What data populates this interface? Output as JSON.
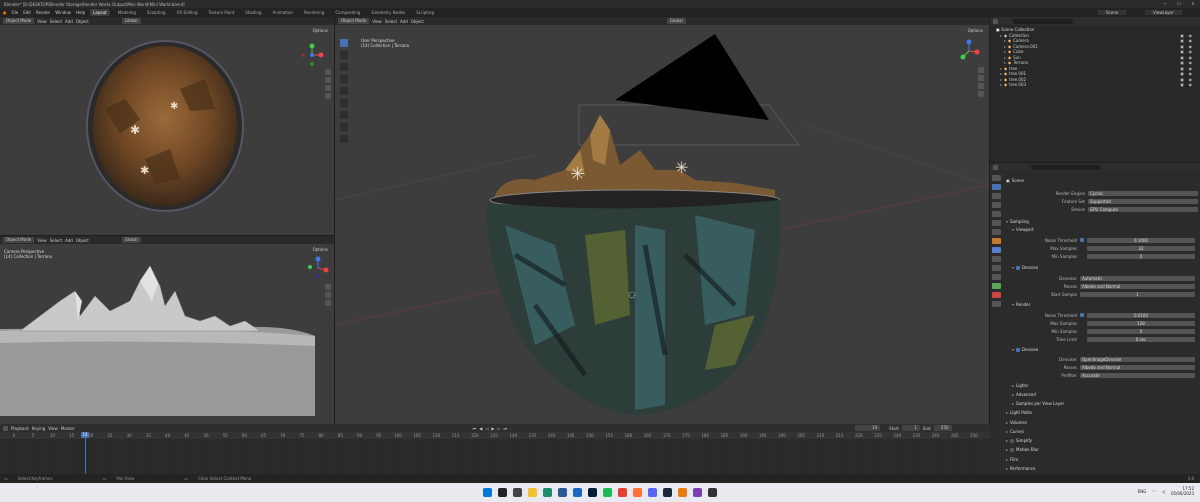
{
  "window": {
    "title": "Blender* [E:\\DESKTOP\\Blender Storage\\Render Works Output\\Mini World\\Mini World.blend]",
    "controls": [
      "—",
      "☐",
      "✕"
    ]
  },
  "menu": {
    "items": [
      "File",
      "Edit",
      "Render",
      "Window",
      "Help"
    ],
    "workspaces": [
      "Layout",
      "Modeling",
      "Sculpting",
      "UV Editing",
      "Texture Paint",
      "Shading",
      "Animation",
      "Rendering",
      "Compositing",
      "Geometry Nodes",
      "Scripting"
    ],
    "active_workspace": "Layout",
    "scene": "Scene",
    "view_layer": "ViewLayer"
  },
  "viewport_header": {
    "mode": "Object Mode",
    "view": "View",
    "select": "Select",
    "add": "Add",
    "object": "Object",
    "orientation": "Global",
    "options": "Options"
  },
  "viewports": {
    "main": {
      "perspective": "User Perspective",
      "collection": "(14) Collection | Terrano"
    },
    "bottom_left": {
      "perspective": "Camera Perspective",
      "collection": "(14) Collection | Terrano"
    }
  },
  "outliner": {
    "root": "Scene Collection",
    "items": [
      {
        "name": "Collection",
        "depth": 1
      },
      {
        "name": "Camera",
        "depth": 2
      },
      {
        "name": "Camera.001",
        "depth": 2
      },
      {
        "name": "Cube",
        "depth": 2
      },
      {
        "name": "Sun",
        "depth": 2
      },
      {
        "name": "Terrano",
        "depth": 2
      },
      {
        "name": "tree",
        "depth": 1
      },
      {
        "name": "tree.001",
        "depth": 1
      },
      {
        "name": "tree.002",
        "depth": 1
      },
      {
        "name": "tree.003",
        "depth": 1
      }
    ]
  },
  "properties": {
    "scene_name": "Scene",
    "render_engine": {
      "label": "Render Engine",
      "value": "Cycles"
    },
    "feature_set": {
      "label": "Feature Set",
      "value": "Supported"
    },
    "device": {
      "label": "Device",
      "value": "GPU Compute"
    },
    "sampling": "Sampling",
    "viewport": {
      "title": "Viewport",
      "noise_threshold": {
        "label": "Noise Threshold",
        "value": "0.1000"
      },
      "max_samples": {
        "label": "Max Samples",
        "value": "32"
      },
      "min_samples": {
        "label": "Min Samples",
        "value": "0"
      },
      "denoise": "Denoise",
      "denoiser": {
        "label": "Denoiser",
        "value": "Automatic"
      },
      "passes": {
        "label": "Passes",
        "value": "Albedo and Normal"
      },
      "start_sample": {
        "label": "Start Sample",
        "value": "1"
      }
    },
    "render": {
      "title": "Render",
      "noise_threshold": {
        "label": "Noise Threshold",
        "value": "0.0100"
      },
      "max_samples": {
        "label": "Max Samples",
        "value": "128"
      },
      "min_samples": {
        "label": "Min Samples",
        "value": "0"
      },
      "time_limit": {
        "label": "Time Limit",
        "value": "0 sec"
      },
      "denoise": "Denoise",
      "denoiser": {
        "label": "Denoiser",
        "value": "OpenImageDenoise"
      },
      "passes": {
        "label": "Passes",
        "value": "Albedo and Normal"
      },
      "prefilter": {
        "label": "Prefilter",
        "value": "Accurate"
      }
    },
    "subsections": [
      "Lights",
      "Advanced",
      "Samples per View Layer"
    ],
    "panels": [
      "Light Paths",
      "Volumes",
      "Curves",
      "Simplify",
      "Motion Blur",
      "Film",
      "Performance"
    ]
  },
  "timeline": {
    "menu": [
      "Playback",
      "Keying",
      "View",
      "Marker"
    ],
    "current_frame": "14",
    "start_label": "Start",
    "start": "1",
    "end_label": "End",
    "end": "250",
    "ticks": [
      "0",
      "5",
      "10",
      "15",
      "20",
      "25",
      "30",
      "35",
      "40",
      "45",
      "50",
      "55",
      "60",
      "65",
      "70",
      "75",
      "80",
      "85",
      "90",
      "95",
      "100",
      "105",
      "110",
      "115",
      "120",
      "125",
      "130",
      "135",
      "140",
      "145",
      "150",
      "155",
      "160",
      "165",
      "170",
      "175",
      "180",
      "185",
      "190",
      "195",
      "200",
      "205",
      "210",
      "215",
      "220",
      "225",
      "230",
      "235",
      "240",
      "245",
      "250"
    ]
  },
  "status": {
    "left": "Select Keyframes",
    "mid": "Pan View",
    "right": "Clear Select Context Menu",
    "version": "3.6"
  },
  "taskbar": {
    "clock_time": "17:52",
    "clock_date": "05/06/2023",
    "lang": "ENG"
  }
}
